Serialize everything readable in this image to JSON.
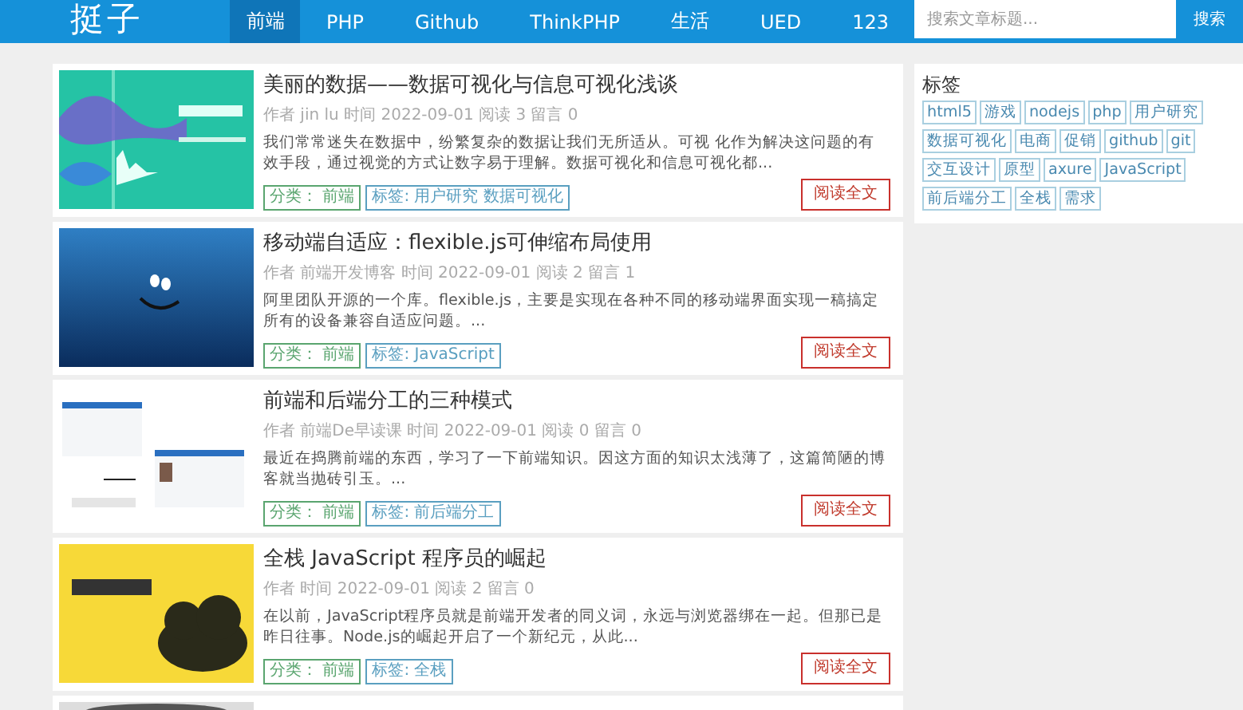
{
  "header": {
    "logo": "挺子",
    "nav": [
      {
        "label": "前端",
        "selected": true
      },
      {
        "label": "PHP",
        "selected": false
      },
      {
        "label": "Github",
        "selected": false
      },
      {
        "label": "ThinkPHP",
        "selected": false
      },
      {
        "label": "生活",
        "selected": false
      },
      {
        "label": "UED",
        "selected": false
      },
      {
        "label": "123",
        "selected": false
      }
    ],
    "search": {
      "placeholder": "搜索文章标题...",
      "button": "搜索"
    }
  },
  "posts": [
    {
      "title": "美丽的数据——数据可视化与信息可视化浅谈",
      "meta": "作者 jin lu 时间 2022-09-01 阅读 3 留言 0",
      "excerpt": "我们常常迷失在数据中，纷繁复杂的数据让我们无所适从。可视 化作为解决这问题的有效手段，通过视觉的方式让数字易于理解。数据可视化和信息可视化都...",
      "category": "分类： 前端",
      "tags": "标签: 用户研究 数据可视化",
      "read_more": "阅读全文"
    },
    {
      "title": "移动端自适应：flexible.js可伸缩布局使用",
      "meta": "作者 前端开发博客 时间 2022-09-01 阅读 2 留言 1",
      "excerpt": "阿里团队开源的一个库。flexible.js，主要是实现在各种不同的移动端界面实现一稿搞定所有的设备兼容自适应问题。...",
      "category": "分类： 前端",
      "tags": "标签: JavaScript",
      "read_more": "阅读全文"
    },
    {
      "title": "前端和后端分工的三种模式",
      "meta": "作者 前端De早读课 时间 2022-09-01 阅读 0 留言 0",
      "excerpt": "最近在捣腾前端的东西，学习了一下前端知识。因这方面的知识太浅薄了，这篇简陋的博客就当抛砖引玉。...",
      "category": "分类： 前端",
      "tags": "标签: 前后端分工",
      "read_more": "阅读全文"
    },
    {
      "title": "全栈 JavaScript 程序员的崛起",
      "meta": "作者 时间 2022-09-01 阅读 2 留言 0",
      "excerpt": "在以前，JavaScript程序员就是前端开发者的同义词，永远与浏览器绑在一起。但那已是昨日往事。Node.js的崛起开启了一个新纪元，从此...",
      "category": "分类： 前端",
      "tags": "标签: 全栈",
      "read_more": "阅读全文"
    }
  ],
  "sidebar": {
    "title": "标签",
    "tags": [
      "html5",
      "游戏",
      "nodejs",
      "php",
      "用户研究",
      "数据可视化",
      "电商",
      "促销",
      "github",
      "git",
      "交互设计",
      "原型",
      "axure",
      "JavaScript",
      "前后端分工",
      "全栈",
      "需求"
    ]
  }
}
